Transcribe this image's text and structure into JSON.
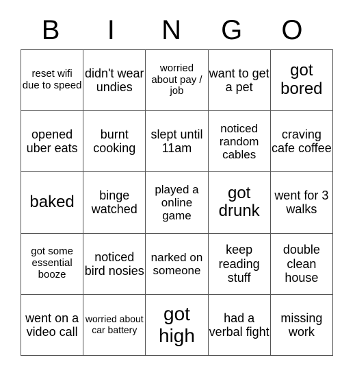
{
  "card": {
    "header_letters": [
      "B",
      "I",
      "N",
      "G",
      "O"
    ],
    "rows": [
      [
        {
          "text": "reset wifi due to speed",
          "size": "sz-s"
        },
        {
          "text": "didn't wear undies",
          "size": "sz-l"
        },
        {
          "text": "worried about pay / job",
          "size": "sz-s"
        },
        {
          "text": "want to get a pet",
          "size": "sz-l"
        },
        {
          "text": "got bored",
          "size": "sz-xl"
        }
      ],
      [
        {
          "text": "opened uber eats",
          "size": "sz-l"
        },
        {
          "text": "burnt cooking",
          "size": "sz-l"
        },
        {
          "text": "slept until 11am",
          "size": "sz-l"
        },
        {
          "text": "noticed random cables",
          "size": "sz-m"
        },
        {
          "text": "craving cafe coffee",
          "size": "sz-l"
        }
      ],
      [
        {
          "text": "baked",
          "size": "sz-xl"
        },
        {
          "text": "binge watched",
          "size": "sz-l"
        },
        {
          "text": "played a online game",
          "size": "sz-m"
        },
        {
          "text": "got drunk",
          "size": "sz-xl"
        },
        {
          "text": "went for 3 walks",
          "size": "sz-l"
        }
      ],
      [
        {
          "text": "got some essential booze",
          "size": "sz-s"
        },
        {
          "text": "noticed bird nosies",
          "size": "sz-l"
        },
        {
          "text": "narked on someone",
          "size": "sz-m"
        },
        {
          "text": "keep reading stuff",
          "size": "sz-l"
        },
        {
          "text": "double clean house",
          "size": "sz-l"
        }
      ],
      [
        {
          "text": "went on a video call",
          "size": "sz-l"
        },
        {
          "text": "worried about car battery",
          "size": "sz-xs"
        },
        {
          "text": "got high",
          "size": "sz-xxl"
        },
        {
          "text": "had a verbal fight",
          "size": "sz-l"
        },
        {
          "text": "missing work",
          "size": "sz-l"
        }
      ]
    ]
  }
}
